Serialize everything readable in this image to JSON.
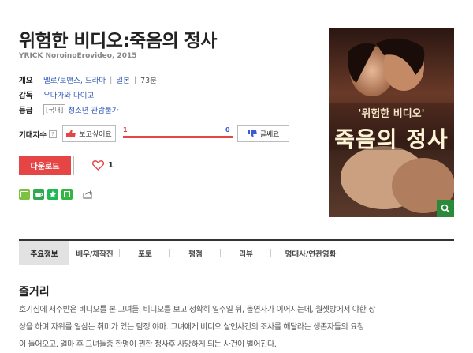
{
  "movie": {
    "title": "위험한 비디오:죽음의 정사",
    "subtitle": "YRICK NoroinoErovideo, 2015"
  },
  "info": {
    "genre_label": "개요",
    "genre": "멜로/로맨스, 드라마",
    "country": "일본",
    "runtime": "73분",
    "director_label": "감독",
    "director": "우다가와 다이고",
    "rating_label": "등급",
    "rating_region": "[국내]",
    "rating": "청소년 관람불가"
  },
  "expect": {
    "label": "기대지수",
    "help": "?",
    "want_label": "보고싶어요",
    "want_count": "1",
    "meh_count": "0",
    "meh_label": "글쎄요"
  },
  "actions": {
    "download": "다운로드",
    "like_count": "1"
  },
  "share": {
    "colors": [
      "#7cc242",
      "#2fa84f",
      "#1fb856",
      "#33b543"
    ]
  },
  "poster": {
    "title_small": "'위험한 비디오'",
    "title_large": "죽음의 정사"
  },
  "tabs": [
    "주요정보",
    "배우/제작진",
    "포토",
    "평점",
    "리뷰",
    "명대사/연관영화"
  ],
  "synopsis": {
    "heading": "줄거리",
    "line1": "호기심에 저주받은 비디오를 본 그녀들. 비디오를 보고 정확히 일주일 뒤, 돌연사가 이어지는데, 월셋방에서 야한 상",
    "line2": "상을 하며 자위를 일삼는 취미가 있는 탐정 야마. 그녀에게 비디오 살인사건의 조사를 해달라는 생존자들의 요청",
    "line3": "이 들어오고, 얼마 후 그녀들중 한명이 찐한 정사후 사망하게 되는 사건이 벌어진다."
  }
}
